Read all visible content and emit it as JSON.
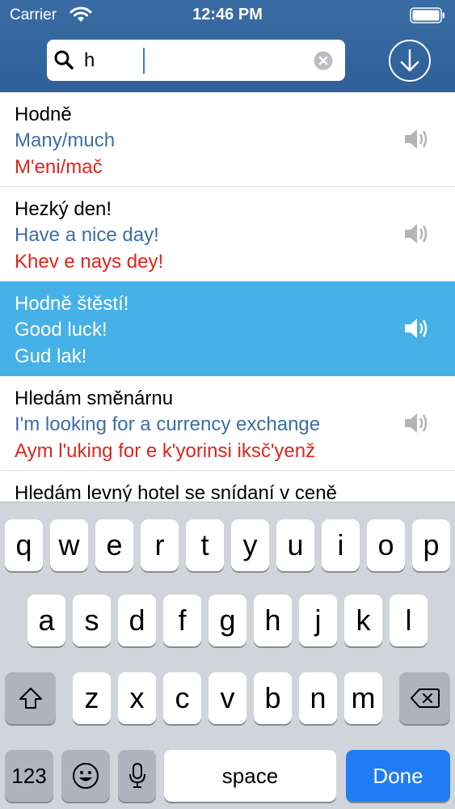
{
  "status_bar": {
    "carrier": "Carrier",
    "time": "12:46 PM"
  },
  "search": {
    "value": "h",
    "placeholder": ""
  },
  "phrases": [
    {
      "czech": "Hodně",
      "english": "Many/much",
      "pronunciation": "M'eni/mač",
      "selected": false
    },
    {
      "czech": "Hezký den!",
      "english": "Have a nice day!",
      "pronunciation": "Khev e nays dey!",
      "selected": false
    },
    {
      "czech": "Hodně štěstí!",
      "english": "Good luck!",
      "pronunciation": "Gud lak!",
      "selected": true
    },
    {
      "czech": "Hledám směnárnu",
      "english": "I'm looking for a currency exchange",
      "pronunciation": "Aym l'uking for e k'yorinsi iksč'yenž",
      "selected": false
    },
    {
      "czech": "Hledám levný hotel se snídaní v ceně",
      "english": "",
      "pronunciation": "",
      "selected": false
    }
  ],
  "keyboard": {
    "row1": [
      "q",
      "w",
      "e",
      "r",
      "t",
      "y",
      "u",
      "i",
      "o",
      "p"
    ],
    "row2": [
      "a",
      "s",
      "d",
      "f",
      "g",
      "h",
      "j",
      "k",
      "l"
    ],
    "row3": [
      "z",
      "x",
      "c",
      "v",
      "b",
      "n",
      "m"
    ],
    "numbers_label": "123",
    "space_label": "space",
    "done_label": "Done"
  },
  "colors": {
    "header": "#2f6099",
    "selected_row": "#45b1e6",
    "english_text": "#3c6ea7",
    "pronunciation_text": "#e0241c",
    "done_key": "#1f7cf5"
  }
}
